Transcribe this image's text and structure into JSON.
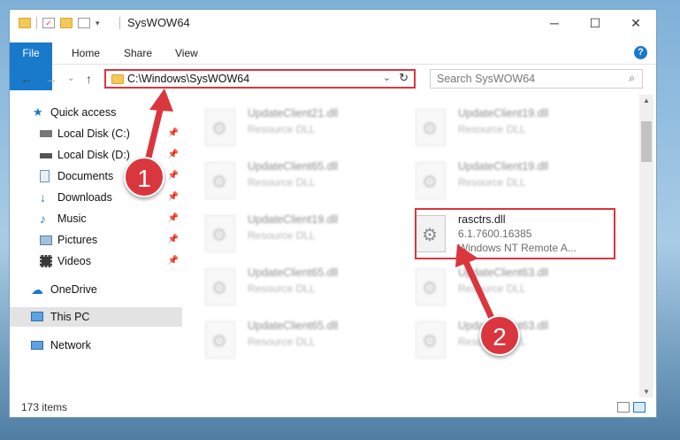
{
  "window": {
    "title": "SysWOW64",
    "controls": {
      "minimize": "─",
      "maximize": "☐",
      "close": "✕"
    }
  },
  "ribbon": {
    "tabs": [
      "File",
      "Home",
      "Share",
      "View"
    ],
    "help": "?"
  },
  "navigation": {
    "back": "←",
    "forward": "→",
    "recent": "⌄",
    "up": "↑",
    "address": "C:\\Windows\\SysWOW64",
    "dropdown": "⌄",
    "refresh": "↻",
    "search_placeholder": "Search SysWOW64",
    "search_icon": "⌕"
  },
  "sidebar": {
    "items": [
      {
        "label": "Quick access",
        "icon": "star-icon"
      },
      {
        "label": "Local Disk (C:)",
        "icon": "drive-icon"
      },
      {
        "label": "Local Disk (D:)",
        "icon": "drive-icon"
      },
      {
        "label": "Documents",
        "icon": "documents-icon"
      },
      {
        "label": "Downloads",
        "icon": "download-icon"
      },
      {
        "label": "Music",
        "icon": "music-icon"
      },
      {
        "label": "Pictures",
        "icon": "pictures-icon"
      },
      {
        "label": "Videos",
        "icon": "videos-icon"
      },
      {
        "label": "OneDrive",
        "icon": "cloud-icon"
      },
      {
        "label": "This PC",
        "icon": "monitor-icon"
      },
      {
        "label": "Network",
        "icon": "network-icon"
      }
    ],
    "pin": "📌"
  },
  "files": [
    {
      "name": "UpdateClient21.dll",
      "type": "Resource DLL"
    },
    {
      "name": "UpdateClient19.dll",
      "type": "Resource DLL"
    },
    {
      "name": "UpdateClient65.dll",
      "type": "Resource DLL"
    },
    {
      "name": "UpdateClient19.dll",
      "type": "Resource DLL"
    },
    {
      "name": "UpdateClient19.dll",
      "type": "Resource DLL"
    },
    {
      "name": "rasctrs.dll",
      "version": "6.1.7600.16385",
      "description": "Windows NT Remote A..."
    },
    {
      "name": "UpdateClient65.dll",
      "type": "Resource DLL"
    },
    {
      "name": "UpdateClient63.dll",
      "type": "Resource DLL"
    },
    {
      "name": "UpdateClient65.dll",
      "type": "Resource DLL"
    },
    {
      "name": "UpdateClient63.dll",
      "type": "Resource DLL"
    }
  ],
  "status": {
    "item_count": "173 items"
  },
  "annotations": {
    "step1": "1",
    "step2": "2"
  },
  "colors": {
    "accent": "#1979ca",
    "highlight": "#d9363e"
  }
}
